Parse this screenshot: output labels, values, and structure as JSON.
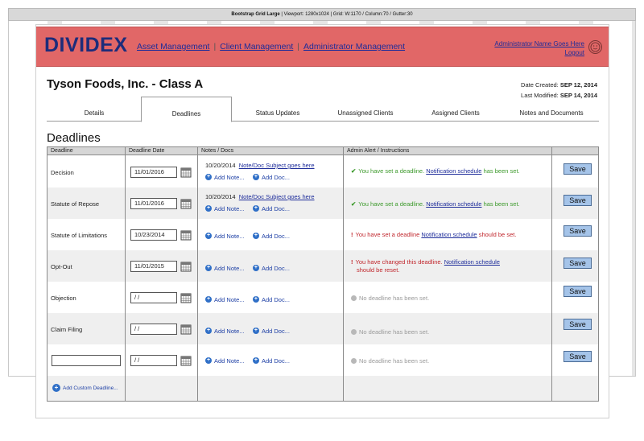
{
  "grid_overlay": {
    "title": "Bootstrap Grid Large",
    "details": "| Viewport: 1280x1024 | Grid: W:1170 / Column:70 / Gutter:30"
  },
  "header": {
    "logo": "DIVIDEX",
    "nav": [
      "Asset Management",
      "Client Management",
      "Administrator Management"
    ],
    "admin_name": "Administrator Name Goes Here",
    "logout": "Logout",
    "bg_color": "#e16767",
    "logo_color": "#1d2c7a"
  },
  "page": {
    "title": "Tyson Foods, Inc. - Class A",
    "created_label": "Date Created:",
    "created_value": "SEP 12, 2014",
    "modified_label": "Last Modified:",
    "modified_value": "SEP 14, 2014"
  },
  "tabs": [
    "Details",
    "Deadlines",
    "Status Updates",
    "Unassigned Clients",
    "Assigned Clients",
    "Notes and Documents"
  ],
  "active_tab": "Deadlines",
  "deadlines": {
    "section_title": "Deadlines",
    "columns": [
      "Deadline",
      "Deadline Date",
      "Notes / Docs",
      "Admin Alert / Instructions"
    ],
    "add_note": "Add Note...",
    "add_doc": "Add Doc...",
    "save_label": "Save",
    "add_custom": "Add Custom Deadline...",
    "rows": [
      {
        "name": "Decision",
        "date": "11/01/2016",
        "note_date": "10/20/2014",
        "note_subject": "Note/Doc Subject goes here",
        "alert_pre": "You have set a deadline.",
        "alert_link": "Notification schedule",
        "alert_post": "has been set."
      },
      {
        "name": "Statute of Repose",
        "date": "11/01/2016",
        "note_date": "10/20/2014",
        "note_subject": "Note/Doc Subject goes here",
        "alert_pre": "You have set a deadline.",
        "alert_link": "Notification schedule",
        "alert_post": "has been set."
      },
      {
        "name": "Statute of Limitations",
        "date": "10/23/2014",
        "alert_pre": "You have set a deadline",
        "alert_link": "Notification schedule",
        "alert_post": "should be set."
      },
      {
        "name": "Opt-Out",
        "date": "11/01/2015",
        "alert_pre": "You have changed this deadline.",
        "alert_link": "Notification schedule",
        "alert_post": "should be reset."
      },
      {
        "name": "Objection",
        "date": "/ /",
        "alert_none": "No deadline has been set."
      },
      {
        "name": "Claim Filing",
        "date": "/ /",
        "alert_none": "No deadline has been set."
      },
      {
        "name": "",
        "date": "/ /",
        "alert_none": "No deadline has been set."
      }
    ]
  },
  "colors": {
    "ok": "#3d9a2c",
    "warn": "#c0262c",
    "link": "#1d2c9a",
    "save_bg": "#a5c4e9"
  }
}
